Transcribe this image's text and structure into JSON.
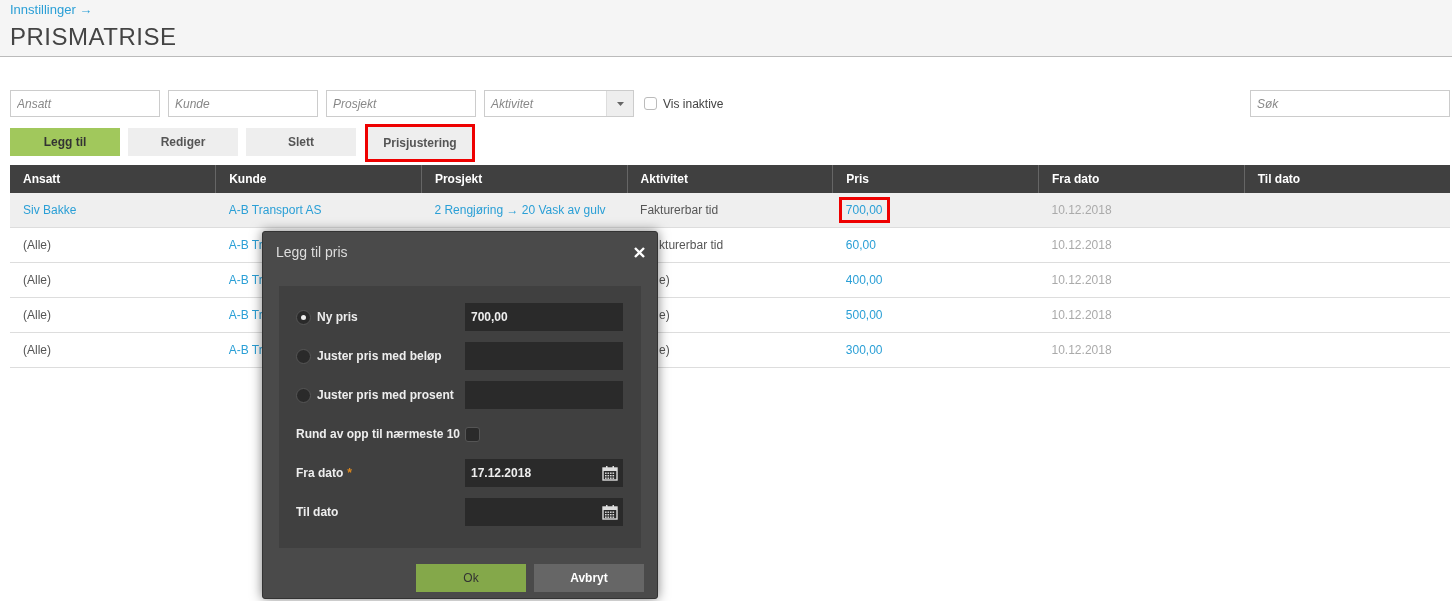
{
  "breadcrumb": "Innstillinger →",
  "title": "PRISMATRISE",
  "filters": [
    {
      "placeholder": "Ansatt"
    },
    {
      "placeholder": "Kunde"
    },
    {
      "placeholder": "Prosjekt"
    }
  ],
  "dropdown": {
    "placeholder": "Aktivitet"
  },
  "show_inactive": {
    "label": "Vis inaktive",
    "checked": false
  },
  "search": {
    "placeholder": "Søk"
  },
  "buttons": [
    {
      "label": "Legg til",
      "kind": "primary",
      "highlighted": false
    },
    {
      "label": "Rediger",
      "kind": "default",
      "highlighted": false
    },
    {
      "label": "Slett",
      "kind": "default",
      "highlighted": false
    },
    {
      "label": "Prisjustering",
      "kind": "default",
      "highlighted": true
    }
  ],
  "table": {
    "columns": [
      "Ansatt",
      "Kunde",
      "Prosjekt",
      "Aktivitet",
      "Pris",
      "Fra dato",
      "Til dato"
    ],
    "rows": [
      {
        "selected": true,
        "cells": [
          {
            "text": "Siv Bakke",
            "kind": "link"
          },
          {
            "text": "A-B Transport AS",
            "kind": "link"
          },
          {
            "text": "2 Rengjøring → 20 Vask av gulv",
            "kind": "link"
          },
          {
            "text": "Fakturerbar tid",
            "kind": "plain"
          },
          {
            "text": "700,00",
            "kind": "link",
            "highlighted": true
          },
          {
            "text": "10.12.2018",
            "kind": "muted"
          }
        ]
      },
      {
        "selected": false,
        "cells": [
          {
            "text": "(Alle)",
            "kind": "plain"
          },
          {
            "text": "A-B Tr",
            "kind": "link"
          },
          null,
          {
            "text": "kturerbar tid",
            "kind": "plain"
          },
          {
            "text": "60,00",
            "kind": "link",
            "highlighted": false
          },
          {
            "text": "10.12.2018",
            "kind": "muted"
          }
        ]
      },
      {
        "selected": false,
        "cells": [
          {
            "text": "(Alle)",
            "kind": "plain"
          },
          {
            "text": "A-B Tr",
            "kind": "link"
          },
          null,
          {
            "text": "e)",
            "kind": "plain"
          },
          {
            "text": "400,00",
            "kind": "link",
            "highlighted": false
          },
          {
            "text": "10.12.2018",
            "kind": "muted"
          }
        ]
      },
      {
        "selected": false,
        "cells": [
          {
            "text": "(Alle)",
            "kind": "plain"
          },
          {
            "text": "A-B Tr",
            "kind": "link"
          },
          null,
          {
            "text": "e)",
            "kind": "plain"
          },
          {
            "text": "500,00",
            "kind": "link",
            "highlighted": false
          },
          {
            "text": "10.12.2018",
            "kind": "muted"
          }
        ]
      },
      {
        "selected": false,
        "cells": [
          {
            "text": "(Alle)",
            "kind": "plain"
          },
          {
            "text": "A-B Tr",
            "kind": "link"
          },
          null,
          {
            "text": "e)",
            "kind": "plain"
          },
          {
            "text": "300,00",
            "kind": "link",
            "highlighted": false
          },
          {
            "text": "10.12.2018",
            "kind": "muted"
          }
        ]
      }
    ]
  },
  "dialog": {
    "title": "Legg til pris",
    "options": [
      {
        "label": "Ny pris",
        "selected": true,
        "value": "700,00"
      },
      {
        "label": "Juster pris med beløp",
        "selected": false
      },
      {
        "label": "Juster pris med prosent",
        "selected": false
      }
    ],
    "round": {
      "label": "Rund av opp til nærmeste 10",
      "checked": false
    },
    "dates": [
      {
        "label": "Fra dato",
        "required_mark": "*",
        "value": "17.12.2018"
      },
      {
        "label": "Til dato"
      }
    ],
    "buttons": [
      {
        "label": "Ok",
        "kind": "primary"
      },
      {
        "label": "Avbryt",
        "kind": "secondary"
      }
    ]
  }
}
